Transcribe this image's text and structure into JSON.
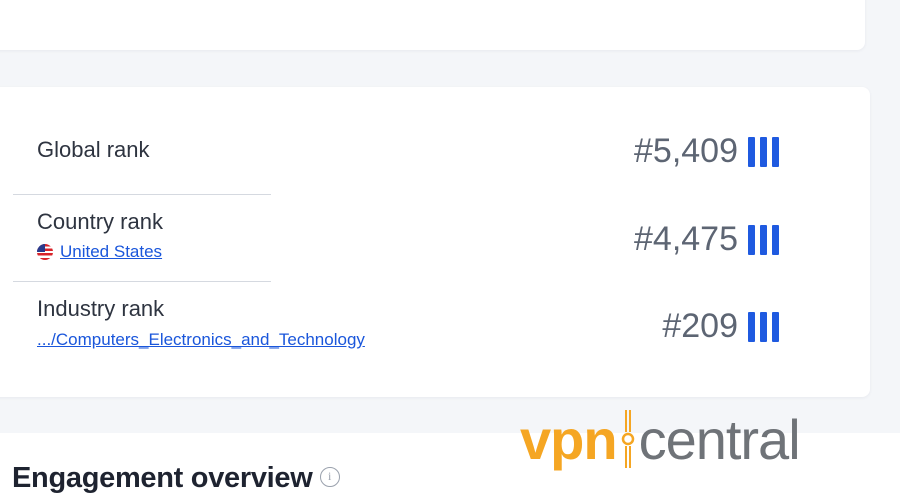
{
  "ranks": [
    {
      "label": "Global rank",
      "value": "#5,409",
      "sub": ""
    },
    {
      "label": "Country rank",
      "value": "#4,475",
      "sub": "United States"
    },
    {
      "label": "Industry rank",
      "value": "#209",
      "sub": ".../Computers_Electronics_and_Technology"
    }
  ],
  "section": {
    "title": "Engagement overview",
    "info_icon_glyph": "i"
  },
  "icons": {
    "flag": "us-flag-icon",
    "bars": "rank-bars-icon",
    "info": "info-icon"
  },
  "watermark": {
    "part1": "vpn",
    "part2": "central"
  },
  "colors": {
    "accent": "#1f5ae0",
    "link": "#1a56db",
    "watermark_orange": "#f5a623",
    "watermark_gray": "#6f7378"
  }
}
